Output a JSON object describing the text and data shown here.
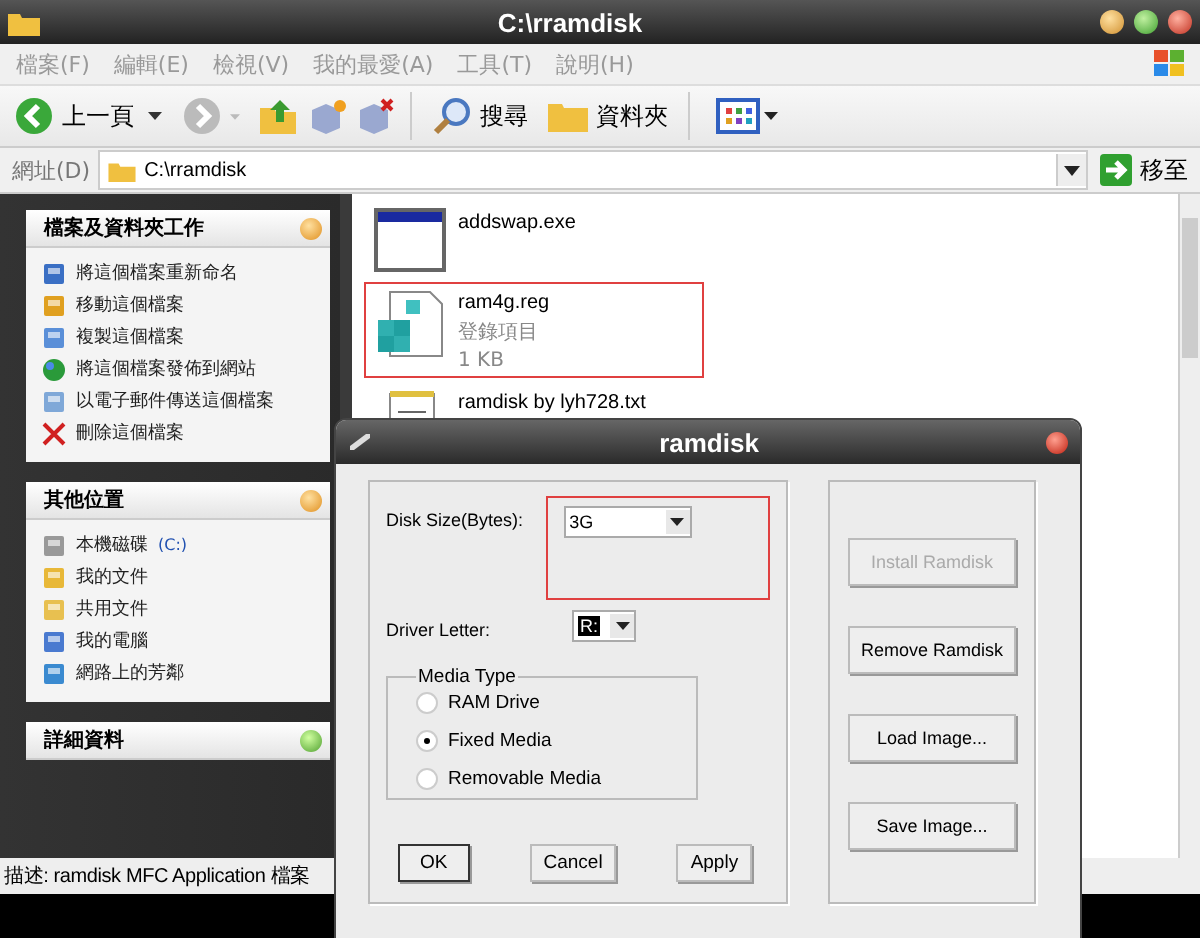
{
  "window": {
    "title": "C:\\rramdisk"
  },
  "menu": [
    "檔案(F)",
    "編輯(E)",
    "檢視(V)",
    "我的最愛(A)",
    "工具(T)",
    "說明(H)"
  ],
  "toolbar": {
    "back": "上一頁",
    "search": "搜尋",
    "folders": "資料夾"
  },
  "address": {
    "label": "網址(D)",
    "value": "C:\\rramdisk",
    "go": "移至"
  },
  "task_panes": [
    {
      "title": "檔案及資料夾工作",
      "expanded": true,
      "items": [
        {
          "label": "將這個檔案重新命名",
          "kind": "rename"
        },
        {
          "label": "移動這個檔案",
          "kind": "move"
        },
        {
          "label": "複製這個檔案",
          "kind": "copy"
        },
        {
          "label": "將這個檔案發佈到網站",
          "kind": "globe"
        },
        {
          "label": "以電子郵件傳送這個檔案",
          "kind": "mail"
        },
        {
          "label": "刪除這個檔案",
          "kind": "delete"
        }
      ]
    },
    {
      "title": "其他位置",
      "expanded": true,
      "items": [
        {
          "label": "本機磁碟",
          "suffix": "(C:)",
          "kind": "drive"
        },
        {
          "label": "我的文件",
          "kind": "docs"
        },
        {
          "label": "共用文件",
          "kind": "folder"
        },
        {
          "label": "我的電腦",
          "kind": "computer"
        },
        {
          "label": "網路上的芳鄰",
          "kind": "network"
        }
      ]
    },
    {
      "title": "詳細資料",
      "expanded": false
    }
  ],
  "files": [
    {
      "name": "addswap.exe",
      "kind": "exe",
      "highlighted": false
    },
    {
      "name": "ram4g.reg",
      "type": "登錄項目",
      "size": "1 KB",
      "kind": "reg",
      "highlighted": true
    },
    {
      "name": "ramdisk by lyh728.txt",
      "kind": "txt",
      "highlighted": false
    }
  ],
  "status_bar": "描述: ramdisk MFC Application 檔案",
  "dialog": {
    "title": "ramdisk",
    "disk_size": {
      "label": "Disk Size(Bytes):",
      "value": "3G",
      "highlighted": true
    },
    "driver_letter": {
      "label": "Driver Letter:",
      "value": "R:"
    },
    "media_type": {
      "title": "Media Type",
      "options": [
        {
          "label": "RAM Drive",
          "selected": false
        },
        {
          "label": "Fixed Media",
          "selected": true
        },
        {
          "label": "Removable Media",
          "selected": false
        }
      ]
    },
    "buttons": [
      {
        "label": "OK",
        "default": true
      },
      {
        "label": "Cancel",
        "default": false
      },
      {
        "label": "Apply",
        "default": false
      }
    ],
    "side_buttons": [
      {
        "label": "Install Ramdisk",
        "disabled": true
      },
      {
        "label": "Remove Ramdisk",
        "disabled": false
      },
      {
        "label": "Load Image...",
        "disabled": false
      },
      {
        "label": "Save Image...",
        "disabled": false
      }
    ]
  }
}
